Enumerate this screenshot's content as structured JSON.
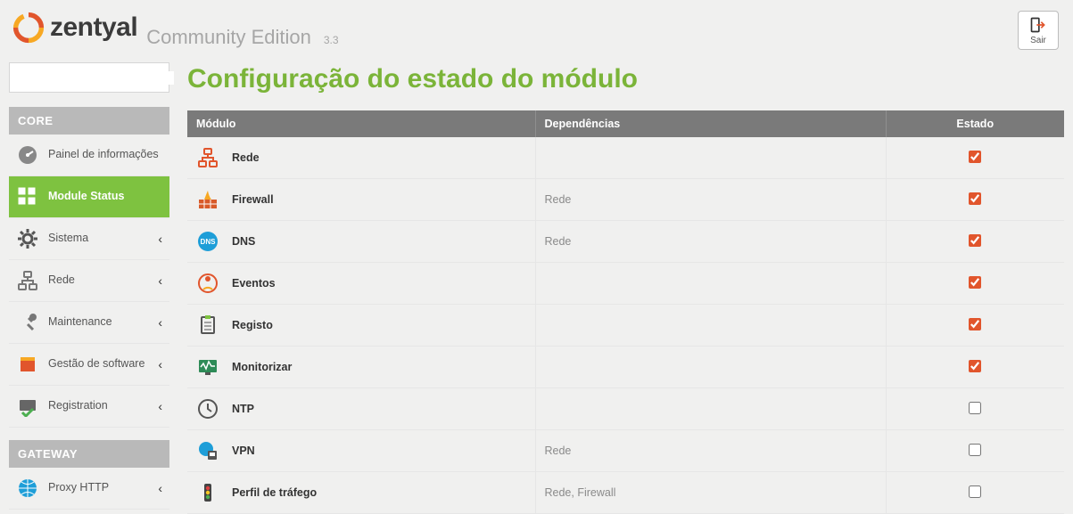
{
  "brand": {
    "name": "zentyal",
    "subtitle": "Community Edition",
    "version": "3.3"
  },
  "logout_label": "Sair",
  "search": {
    "placeholder": ""
  },
  "page_title": "Configuração do estado do módulo",
  "sidebar": {
    "sections": [
      {
        "header": "CORE",
        "items": [
          {
            "label": "Painel de informações",
            "icon": "gauge-icon",
            "active": false,
            "hasSub": false
          },
          {
            "label": "Module Status",
            "icon": "grid-icon",
            "active": true,
            "hasSub": false
          },
          {
            "label": "Sistema",
            "icon": "gear-icon",
            "active": false,
            "hasSub": true
          },
          {
            "label": "Rede",
            "icon": "network-icon",
            "active": false,
            "hasSub": true
          },
          {
            "label": "Maintenance",
            "icon": "tools-icon",
            "active": false,
            "hasSub": true
          },
          {
            "label": "Gestão de software",
            "icon": "package-icon",
            "active": false,
            "hasSub": true
          },
          {
            "label": "Registration",
            "icon": "register-icon",
            "active": false,
            "hasSub": true
          }
        ]
      },
      {
        "header": "GATEWAY",
        "items": [
          {
            "label": "Proxy HTTP",
            "icon": "globe-icon",
            "active": false,
            "hasSub": true
          }
        ]
      }
    ]
  },
  "table": {
    "headers": {
      "col1": "Módulo",
      "col2": "Dependências",
      "col3": "Estado"
    },
    "rows": [
      {
        "icon": "network-icon",
        "name": "Rede",
        "deps": "",
        "checked": true
      },
      {
        "icon": "firewall-icon",
        "name": "Firewall",
        "deps": "Rede",
        "checked": true
      },
      {
        "icon": "dns-icon",
        "name": "DNS",
        "deps": "Rede",
        "checked": true
      },
      {
        "icon": "events-icon",
        "name": "Eventos",
        "deps": "",
        "checked": true
      },
      {
        "icon": "log-icon",
        "name": "Registo",
        "deps": "",
        "checked": true
      },
      {
        "icon": "monitor-icon",
        "name": "Monitorizar",
        "deps": "",
        "checked": true
      },
      {
        "icon": "clock-icon",
        "name": "NTP",
        "deps": "",
        "checked": false
      },
      {
        "icon": "vpn-icon",
        "name": "VPN",
        "deps": "Rede",
        "checked": false
      },
      {
        "icon": "traffic-icon",
        "name": "Perfil de tráfego",
        "deps": "Rede, Firewall",
        "checked": false
      }
    ]
  }
}
